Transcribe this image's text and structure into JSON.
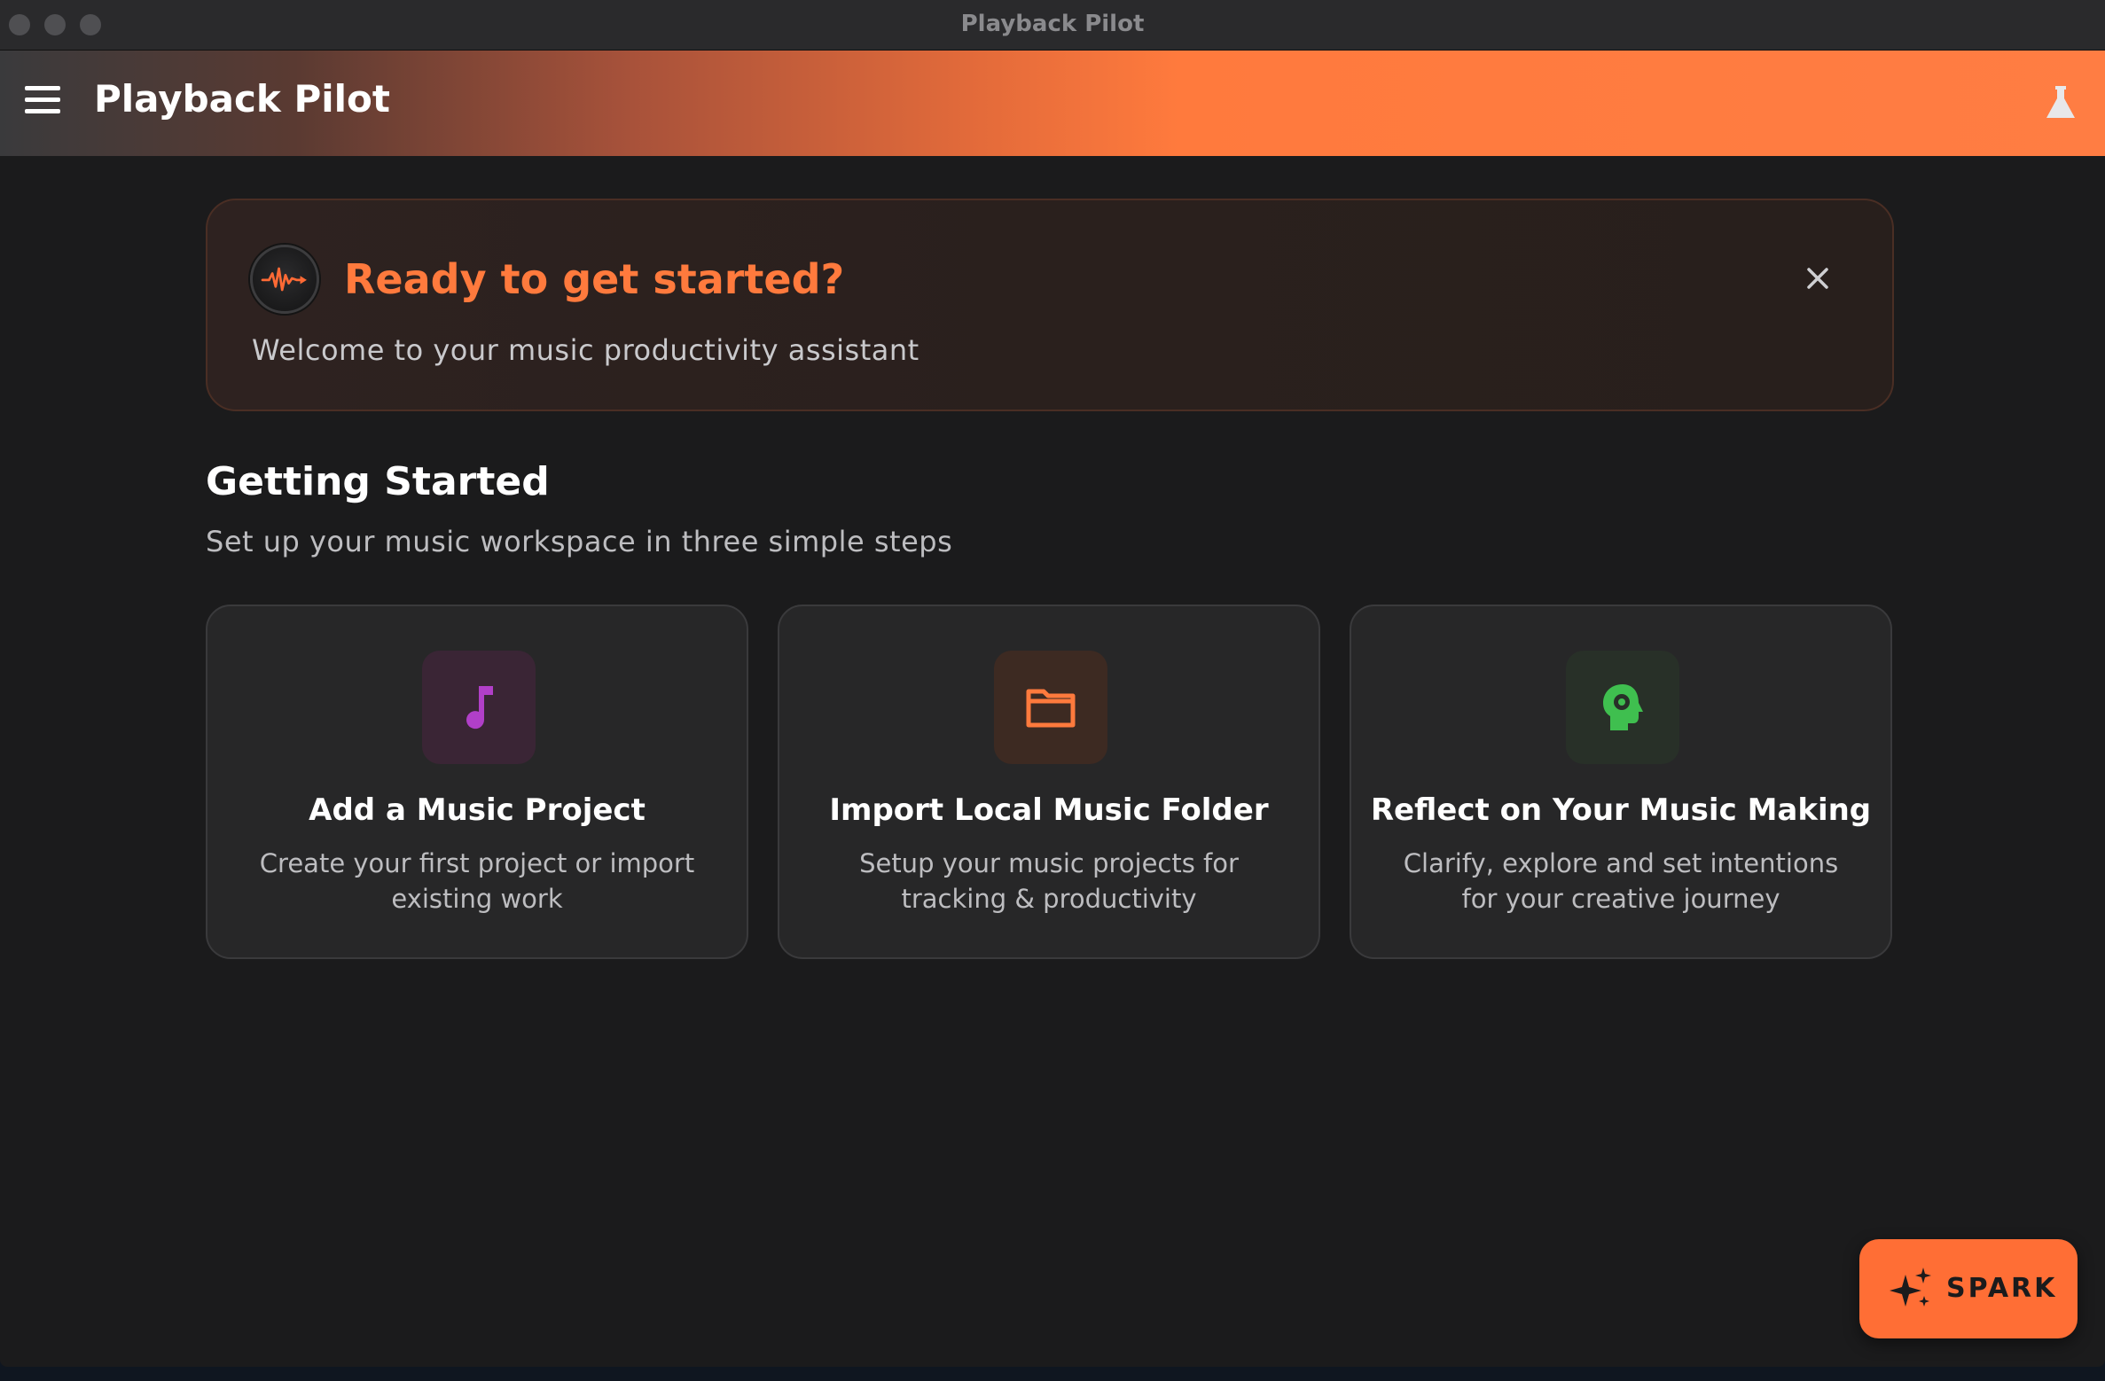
{
  "window": {
    "title": "Playback Pilot"
  },
  "appbar": {
    "title": "Playback Pilot",
    "menu_icon": "hamburger-menu-icon",
    "lab_icon": "flask-icon"
  },
  "banner": {
    "title": "Ready to get started?",
    "subtitle": "Welcome to your music productivity assistant",
    "logo_icon": "waveform-logo-icon",
    "close_icon": "close-icon"
  },
  "getting_started": {
    "title": "Getting Started",
    "subtitle": "Set up your music workspace in three simple steps",
    "cards": [
      {
        "title": "Add a Music Project",
        "description": "Create your first project or import existing work",
        "icon": "music-note-icon",
        "accent": "#b13fc8"
      },
      {
        "title": "Import Local Music Folder",
        "description": "Setup your music projects for tracking & productivity",
        "icon": "folder-icon",
        "accent": "#ff7a3d"
      },
      {
        "title": "Reflect on Your Music Making",
        "description": "Clarify, explore and set intentions for your creative journey",
        "icon": "head-gear-icon",
        "accent": "#3fbf4f"
      }
    ]
  },
  "spark": {
    "label": "SPARK",
    "icon": "sparkle-icon"
  },
  "colors": {
    "accent": "#ff7a3d",
    "background": "#1b1b1c",
    "card": "#272728"
  }
}
